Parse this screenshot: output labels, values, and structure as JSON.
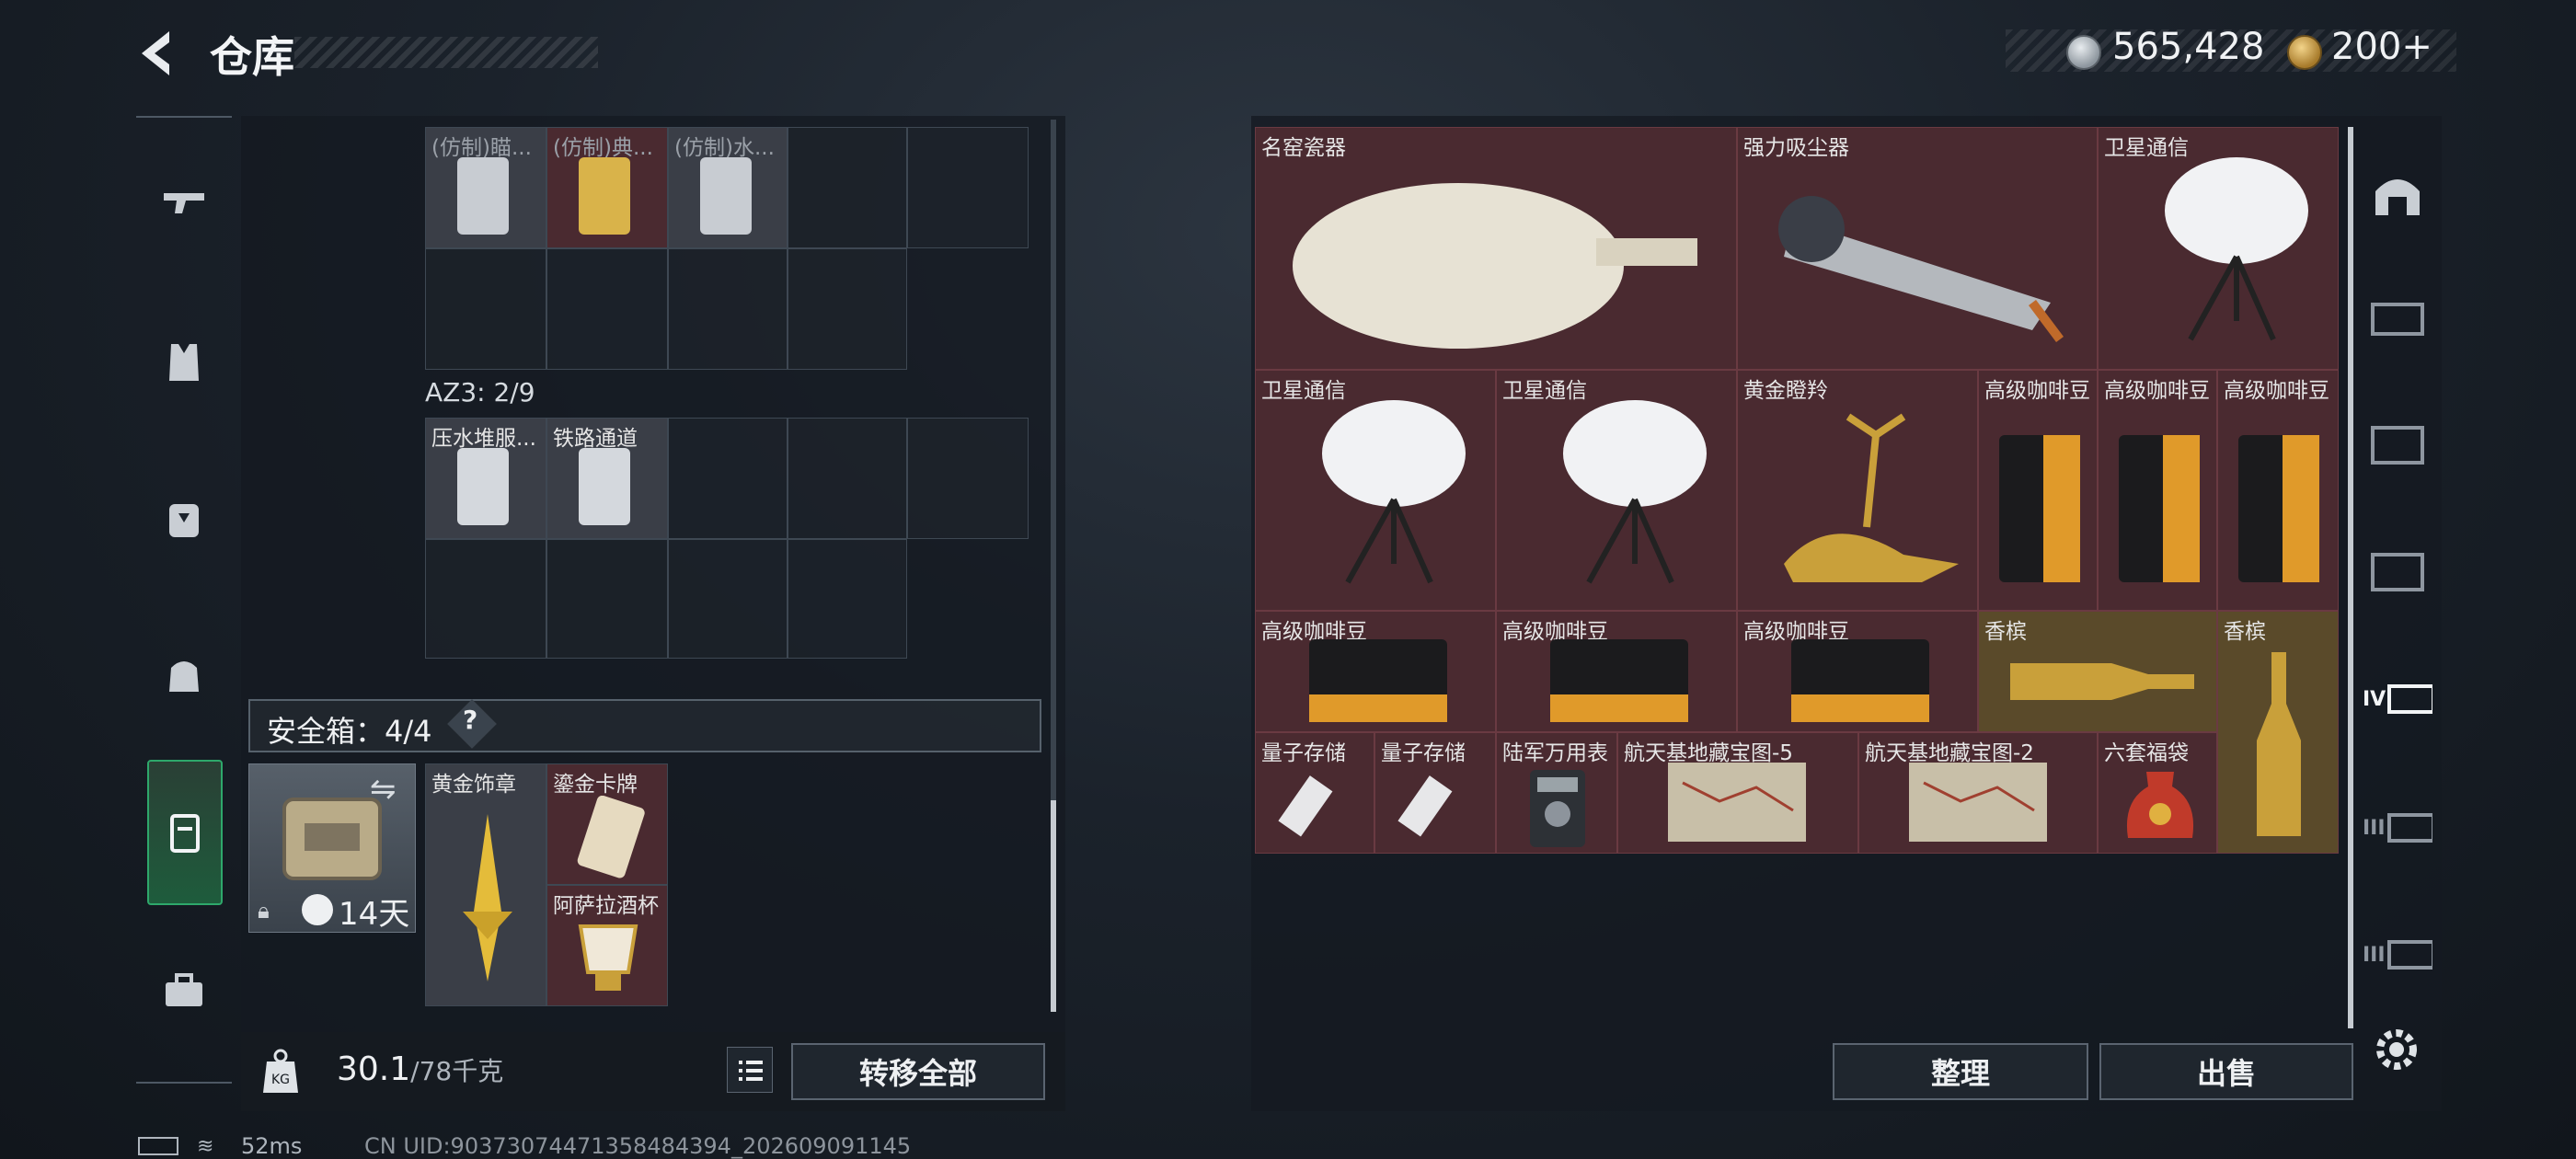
{
  "header": {
    "title": "仓库"
  },
  "currency": {
    "silver": "565,428",
    "gold": "200+"
  },
  "left_storage": {
    "top_items": [
      {
        "label": "(仿制)瞄..."
      },
      {
        "label": "(仿制)典..."
      },
      {
        "label": "(仿制)水..."
      }
    ],
    "az3_label": "AZ3: 2/9",
    "az3_items": [
      {
        "label": "压水堆服..."
      },
      {
        "label": "铁路通道"
      }
    ],
    "safe_box": {
      "label": "安全箱：4/4",
      "help": "?",
      "days": "14天",
      "items": [
        {
          "label": "黄金饰章"
        },
        {
          "label": "鎏金卡牌"
        },
        {
          "label": "阿萨拉酒杯"
        }
      ]
    }
  },
  "weight": {
    "value": "30.1",
    "max": "/78千克"
  },
  "buttons": {
    "transfer_all": "转移全部",
    "sort": "整理",
    "sell": "出售"
  },
  "right_storage": {
    "items": [
      {
        "label": "名窑瓷器"
      },
      {
        "label": "强力吸尘器"
      },
      {
        "label": "卫星通信"
      },
      {
        "label": "卫星通信"
      },
      {
        "label": "卫星通信"
      },
      {
        "label": "黄金瞪羚"
      },
      {
        "label": "高级咖啡豆"
      },
      {
        "label": "高级咖啡豆"
      },
      {
        "label": "高级咖啡豆"
      },
      {
        "label": "高级咖啡豆"
      },
      {
        "label": "高级咖啡豆"
      },
      {
        "label": "高级咖啡豆"
      },
      {
        "label": "香槟"
      },
      {
        "label": "香槟"
      },
      {
        "label": "量子存储"
      },
      {
        "label": "量子存储"
      },
      {
        "label": "陆军万用表"
      },
      {
        "label": "航天基地藏宝图-5"
      },
      {
        "label": "航天基地藏宝图-2"
      },
      {
        "label": "六套福袋"
      }
    ]
  },
  "right_nav": {
    "badges": [
      "IV",
      "III",
      "III"
    ]
  },
  "status": {
    "ping": "52ms",
    "uid": "CN UID:9037307447135848439​4_202609091145"
  }
}
